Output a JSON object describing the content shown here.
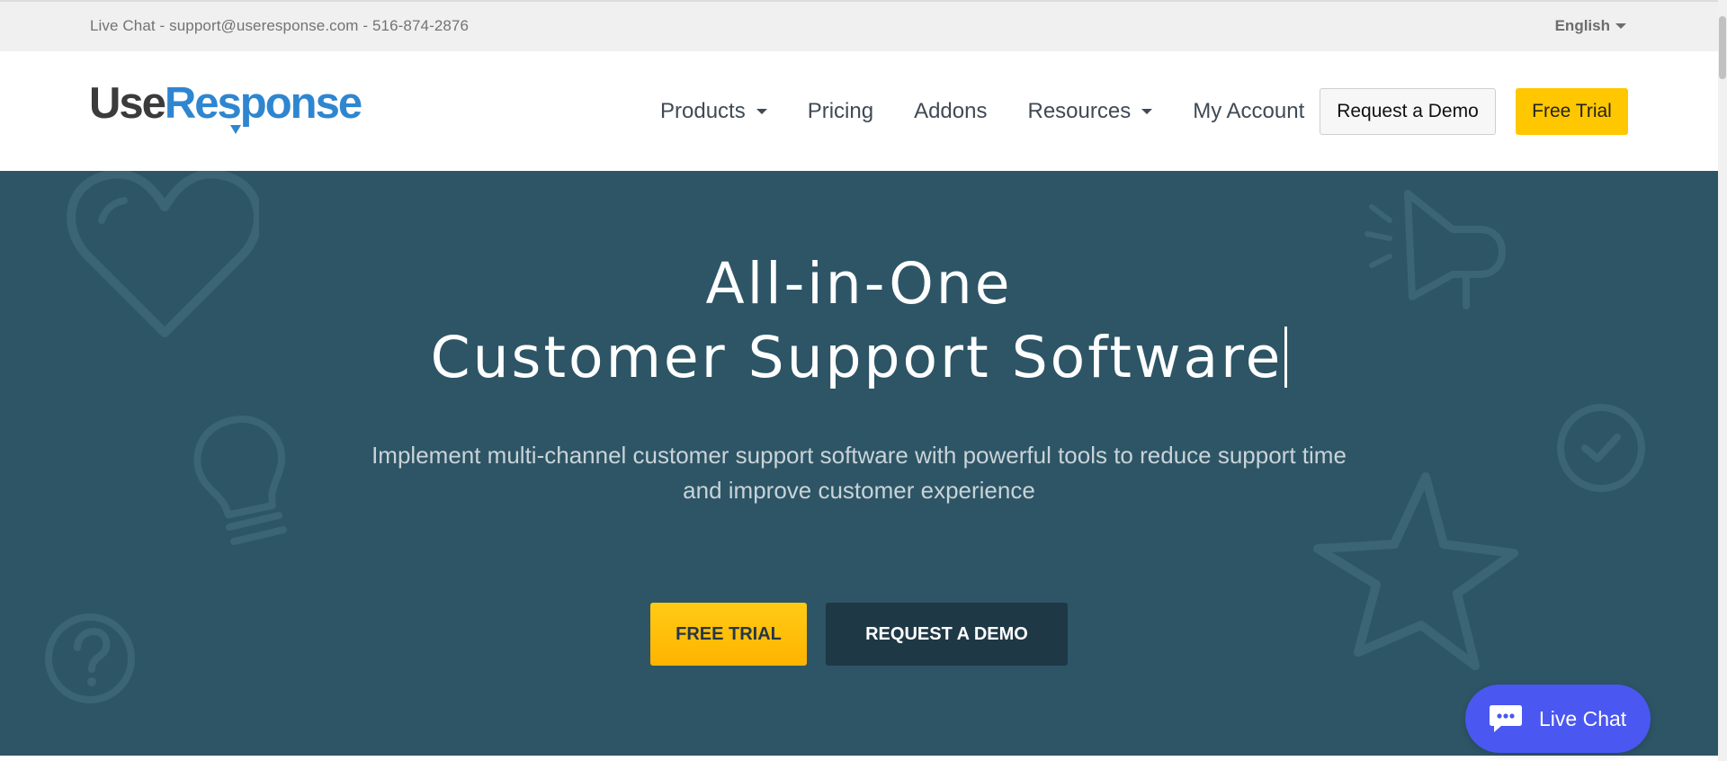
{
  "topbar": {
    "contact": "Live Chat - support@useresponse.com - 516-874-2876",
    "language": "English"
  },
  "header": {
    "logo_use": "Use",
    "logo_response": "Response",
    "nav": [
      {
        "label": "Products",
        "dropdown": true
      },
      {
        "label": "Pricing",
        "dropdown": false
      },
      {
        "label": "Addons",
        "dropdown": false
      },
      {
        "label": "Resources",
        "dropdown": true
      },
      {
        "label": "My Account",
        "dropdown": false
      }
    ],
    "request_demo": "Request a Demo",
    "free_trial": "Free Trial"
  },
  "hero": {
    "title_line1": "All-in-One",
    "title_line2": "Customer Support Software",
    "subtitle": "Implement multi-channel customer support software with powerful tools to reduce support time and improve customer experience",
    "cta_trial": "FREE TRIAL",
    "cta_demo": "REQUEST A DEMO",
    "background_icons": [
      "heart-icon",
      "lightbulb-icon",
      "question-icon",
      "megaphone-icon",
      "check-circle-icon",
      "star-icon"
    ]
  },
  "livechat": {
    "label": "Live Chat",
    "icon": "chat-bubble-icon"
  },
  "colors": {
    "hero_bg": "#2d5566",
    "accent_yellow": "#ffc700",
    "brand_blue": "#2f86d0",
    "chat_blue": "#4a57f0",
    "dark_button": "#1f3846"
  }
}
